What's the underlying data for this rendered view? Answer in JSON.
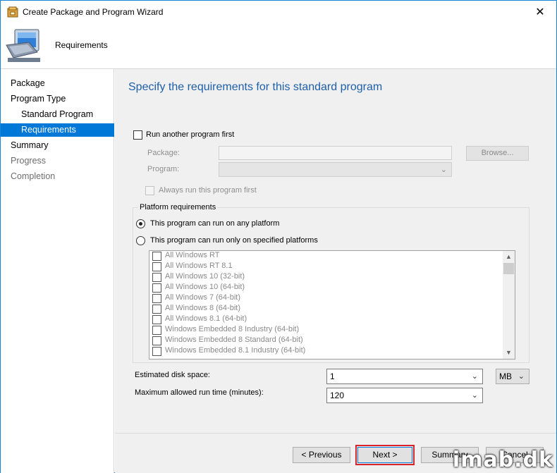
{
  "window": {
    "title": "Create Package and Program Wizard",
    "close_glyph": "✕"
  },
  "header": {
    "page_title": "Requirements",
    "icon": "computer-icon"
  },
  "nav": {
    "items": [
      {
        "label": "Package"
      },
      {
        "label": "Program Type"
      },
      {
        "label": "Standard Program"
      },
      {
        "label": "Requirements"
      },
      {
        "label": "Summary"
      },
      {
        "label": "Progress"
      },
      {
        "label": "Completion"
      }
    ]
  },
  "main": {
    "heading": "Specify the requirements for this standard program",
    "run_another": {
      "label": "Run another program first",
      "package_label": "Package:",
      "program_label": "Program:",
      "browse_label": "Browse...",
      "always_run_label": "Always run this program first"
    },
    "platform": {
      "group_title": "Platform requirements",
      "any_label": "This program can run on any platform",
      "specified_label": "This program can run only on specified platforms",
      "platforms": [
        "All Windows RT",
        "All Windows RT 8.1",
        "All Windows 10 (32-bit)",
        "All Windows 10 (64-bit)",
        "All Windows 7 (64-bit)",
        "All Windows 8 (64-bit)",
        "All Windows 8.1 (64-bit)",
        "Windows Embedded 8 Industry (64-bit)",
        "Windows Embedded 8 Standard (64-bit)",
        "Windows Embedded 8.1 Industry (64-bit)"
      ]
    },
    "disk_space": {
      "label": "Estimated disk space:",
      "value": "1",
      "unit": "MB"
    },
    "run_time": {
      "label": "Maximum allowed run time (minutes):",
      "value": "120"
    }
  },
  "footer": {
    "previous_label": "< Previous",
    "next_label": "Next >",
    "summary_label": "Summary",
    "cancel_label": "Cancel"
  },
  "watermark": "imab.dk"
}
